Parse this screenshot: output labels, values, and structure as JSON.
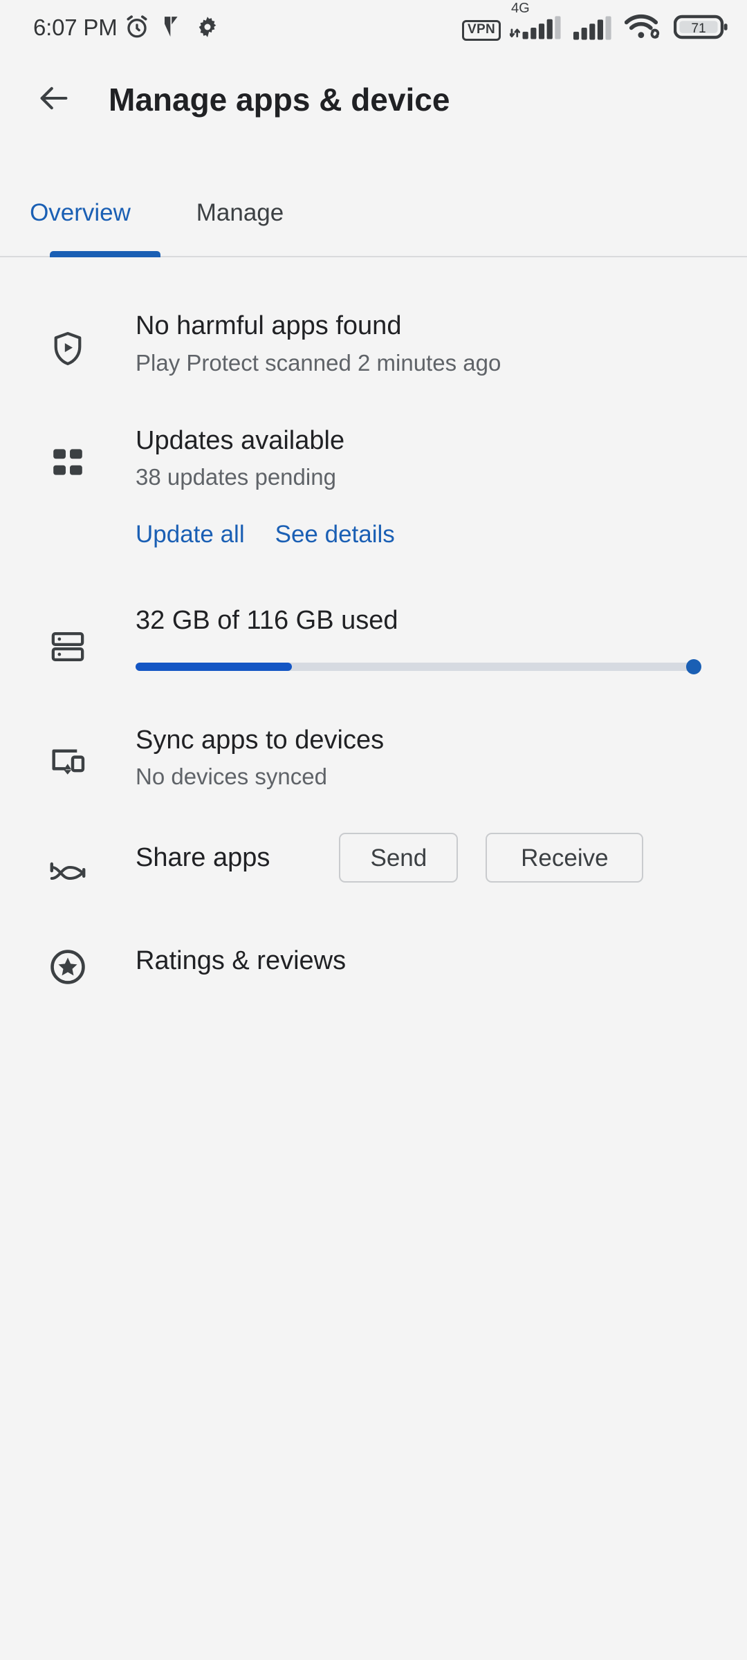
{
  "status_bar": {
    "time": "6:07 PM",
    "icons_left": [
      "alarm-icon",
      "vibrate-icon",
      "settings-gear-icon"
    ],
    "vpn_label": "VPN",
    "network_label": "4G",
    "icons_right": [
      "vpn-badge",
      "signal-4g-icon",
      "signal-secondary-icon",
      "wifi-linked-icon",
      "battery-icon"
    ],
    "battery_percent": "71"
  },
  "app_bar": {
    "back_icon": "back-arrow-icon",
    "title": "Manage apps & device"
  },
  "tabs": {
    "active": "Overview",
    "items": [
      {
        "label": "Overview",
        "active": true
      },
      {
        "label": "Manage",
        "active": false
      }
    ]
  },
  "sections": {
    "play_protect": {
      "icon": "shield-play-icon",
      "title": "No harmful apps found",
      "subtitle": "Play Protect scanned 2 minutes ago"
    },
    "updates": {
      "icon": "grid-apps-icon",
      "title": "Updates available",
      "subtitle": "38 updates pending",
      "update_all_label": "Update all",
      "see_details_label": "See details"
    },
    "storage": {
      "icon": "storage-drive-icon",
      "title": "32 GB of 116 GB used",
      "used_gb": 32,
      "total_gb": 116,
      "percent_used": 28
    },
    "sync": {
      "icon": "devices-sync-icon",
      "title": "Sync apps to devices",
      "subtitle": "No devices synced"
    },
    "share": {
      "icon": "share-nearby-icon",
      "title": "Share apps",
      "send_label": "Send",
      "receive_label": "Receive"
    },
    "ratings": {
      "icon": "star-circle-icon",
      "title": "Ratings & reviews"
    }
  },
  "colors": {
    "accent_blue": "#1a5fb4",
    "progress_blue": "#1456c4",
    "background": "#f4f4f4",
    "text_primary": "#202124",
    "text_secondary": "#5f6368"
  }
}
